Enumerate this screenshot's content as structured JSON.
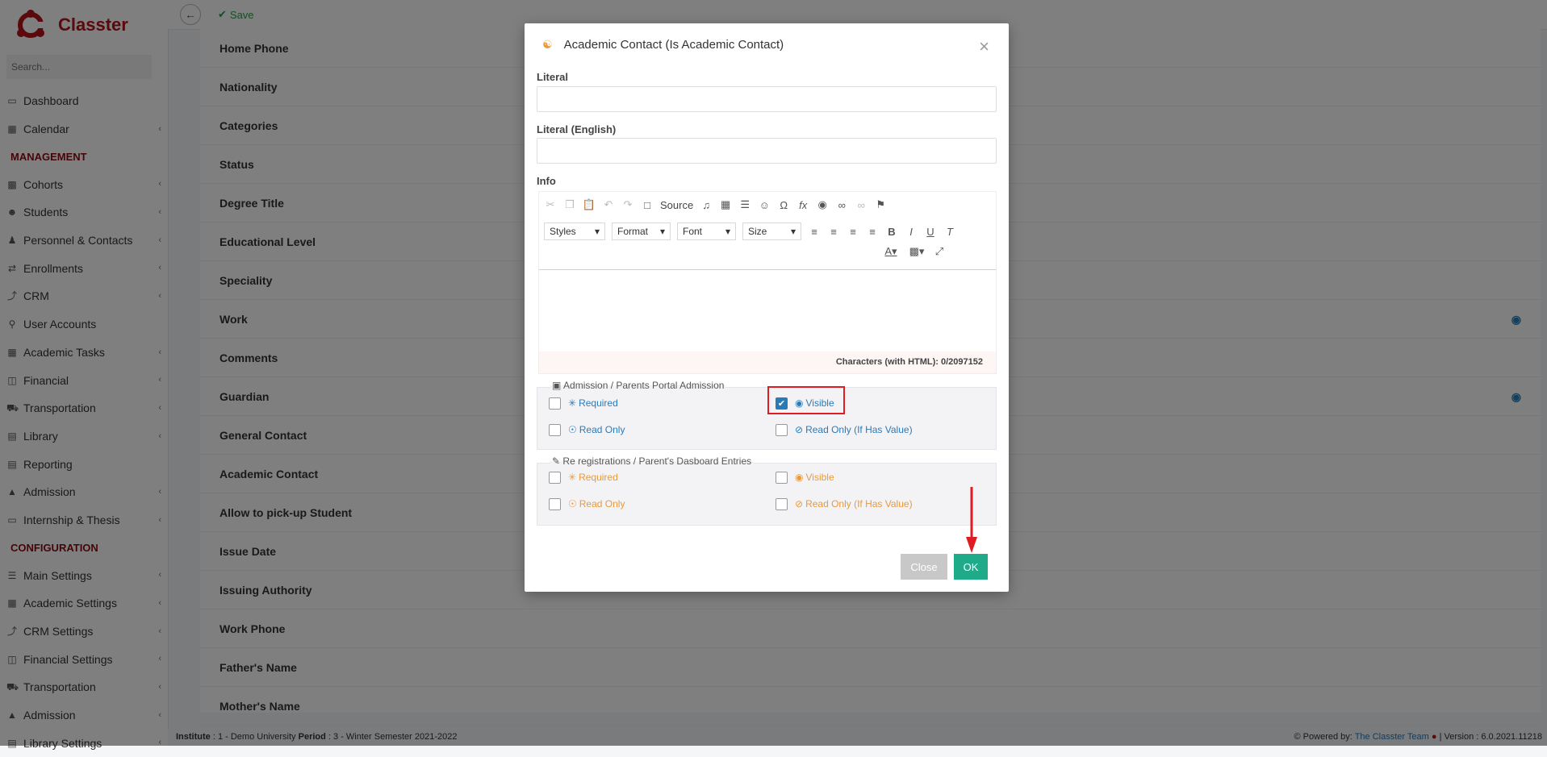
{
  "app": {
    "name": "Classter"
  },
  "sidebar": {
    "search_placeholder": "Search...",
    "items": [
      {
        "type": "item",
        "label": "Dashboard",
        "icon": "monitor-icon",
        "chev": false
      },
      {
        "type": "item",
        "label": "Calendar",
        "icon": "calendar-icon",
        "chev": true
      },
      {
        "type": "section",
        "label": "MANAGEMENT"
      },
      {
        "type": "item",
        "label": "Cohorts",
        "icon": "cohorts-icon",
        "chev": true
      },
      {
        "type": "item",
        "label": "Students",
        "icon": "students-icon",
        "chev": true
      },
      {
        "type": "item",
        "label": "Personnel & Contacts",
        "icon": "personnel-icon",
        "chev": true
      },
      {
        "type": "item",
        "label": "Enrollments",
        "icon": "enrollments-icon",
        "chev": true
      },
      {
        "type": "item",
        "label": "CRM",
        "icon": "crm-icon",
        "chev": true
      },
      {
        "type": "item",
        "label": "User Accounts",
        "icon": "key-icon",
        "chev": false
      },
      {
        "type": "item",
        "label": "Academic Tasks",
        "icon": "tasks-icon",
        "chev": true
      },
      {
        "type": "item",
        "label": "Financial",
        "icon": "financial-icon",
        "chev": true
      },
      {
        "type": "item",
        "label": "Transportation",
        "icon": "bus-icon",
        "chev": true
      },
      {
        "type": "item",
        "label": "Library",
        "icon": "library-icon",
        "chev": true
      },
      {
        "type": "item",
        "label": "Reporting",
        "icon": "printer-icon",
        "chev": false
      },
      {
        "type": "item",
        "label": "Admission",
        "icon": "institution-icon",
        "chev": true
      },
      {
        "type": "item",
        "label": "Internship & Thesis",
        "icon": "cube-icon",
        "chev": true
      },
      {
        "type": "section",
        "label": "CONFIGURATION"
      },
      {
        "type": "item",
        "label": "Main Settings",
        "icon": "sliders-icon",
        "chev": true
      },
      {
        "type": "item",
        "label": "Academic Settings",
        "icon": "grid-icon",
        "chev": true
      },
      {
        "type": "item",
        "label": "CRM Settings",
        "icon": "crm-icon",
        "chev": true
      },
      {
        "type": "item",
        "label": "Financial Settings",
        "icon": "financial-icon",
        "chev": true
      },
      {
        "type": "item",
        "label": "Transportation",
        "icon": "bus-icon",
        "chev": true
      },
      {
        "type": "item",
        "label": "Admission",
        "icon": "institution-icon",
        "chev": true
      },
      {
        "type": "item",
        "label": "Library Settings",
        "icon": "library-icon",
        "chev": true
      }
    ]
  },
  "toolbar": {
    "save_label": "Save"
  },
  "fields": [
    {
      "label": "Home Phone",
      "eye": false
    },
    {
      "label": "Nationality",
      "eye": false
    },
    {
      "label": "Categories",
      "eye": false
    },
    {
      "label": "Status",
      "eye": false
    },
    {
      "label": "Degree Title",
      "eye": false
    },
    {
      "label": "Educational Level",
      "eye": false
    },
    {
      "label": "Speciality",
      "eye": false
    },
    {
      "label": "Work",
      "eye": true
    },
    {
      "label": "Comments",
      "eye": false
    },
    {
      "label": "Guardian",
      "eye": true
    },
    {
      "label": "General Contact",
      "eye": false
    },
    {
      "label": "Academic Contact",
      "eye": false
    },
    {
      "label": "Allow to pick-up Student",
      "eye": false
    },
    {
      "label": "Issue Date",
      "eye": false
    },
    {
      "label": "Issuing Authority",
      "eye": false
    },
    {
      "label": "Work Phone",
      "eye": false
    },
    {
      "label": "Father's Name",
      "eye": false
    },
    {
      "label": "Mother's Name",
      "eye": false
    }
  ],
  "footer": {
    "institute_label": "Institute",
    "institute_value": ": 1 - Demo University",
    "period_label": "Period",
    "period_value": ": 3 - Winter Semester 2021-2022",
    "powered_by": "Powered by:",
    "team": "The Classter Team",
    "version": "| Version : 6.0.2021.11218"
  },
  "modal": {
    "title": "Academic Contact (Is Academic Contact)",
    "literal_label": "Literal",
    "literal_value": "",
    "literal_en_label": "Literal (English)",
    "literal_en_value": "",
    "info_label": "Info",
    "editor": {
      "source_label": "Source",
      "styles": "Styles",
      "format": "Format",
      "font": "Font",
      "size": "Size",
      "char_count": "Characters (with HTML): 0/2097152"
    },
    "group1": {
      "title": "Admission / Parents Portal Admission",
      "required": "Required",
      "visible": "Visible",
      "read_only": "Read Only",
      "read_only_if": "Read Only (If Has Value)",
      "visible_checked": true
    },
    "group2": {
      "title": "Re registrations / Parent's Dasboard Entries",
      "required": "Required",
      "visible": "Visible",
      "read_only": "Read Only",
      "read_only_if": "Read Only (If Has Value)"
    },
    "close_label": "Close",
    "ok_label": "OK"
  },
  "colors": {
    "brand": "#b5121b",
    "ok": "#1fab89",
    "link": "#2a7ab8",
    "warn": "#e89a3c",
    "highlight": "#e01b22"
  }
}
